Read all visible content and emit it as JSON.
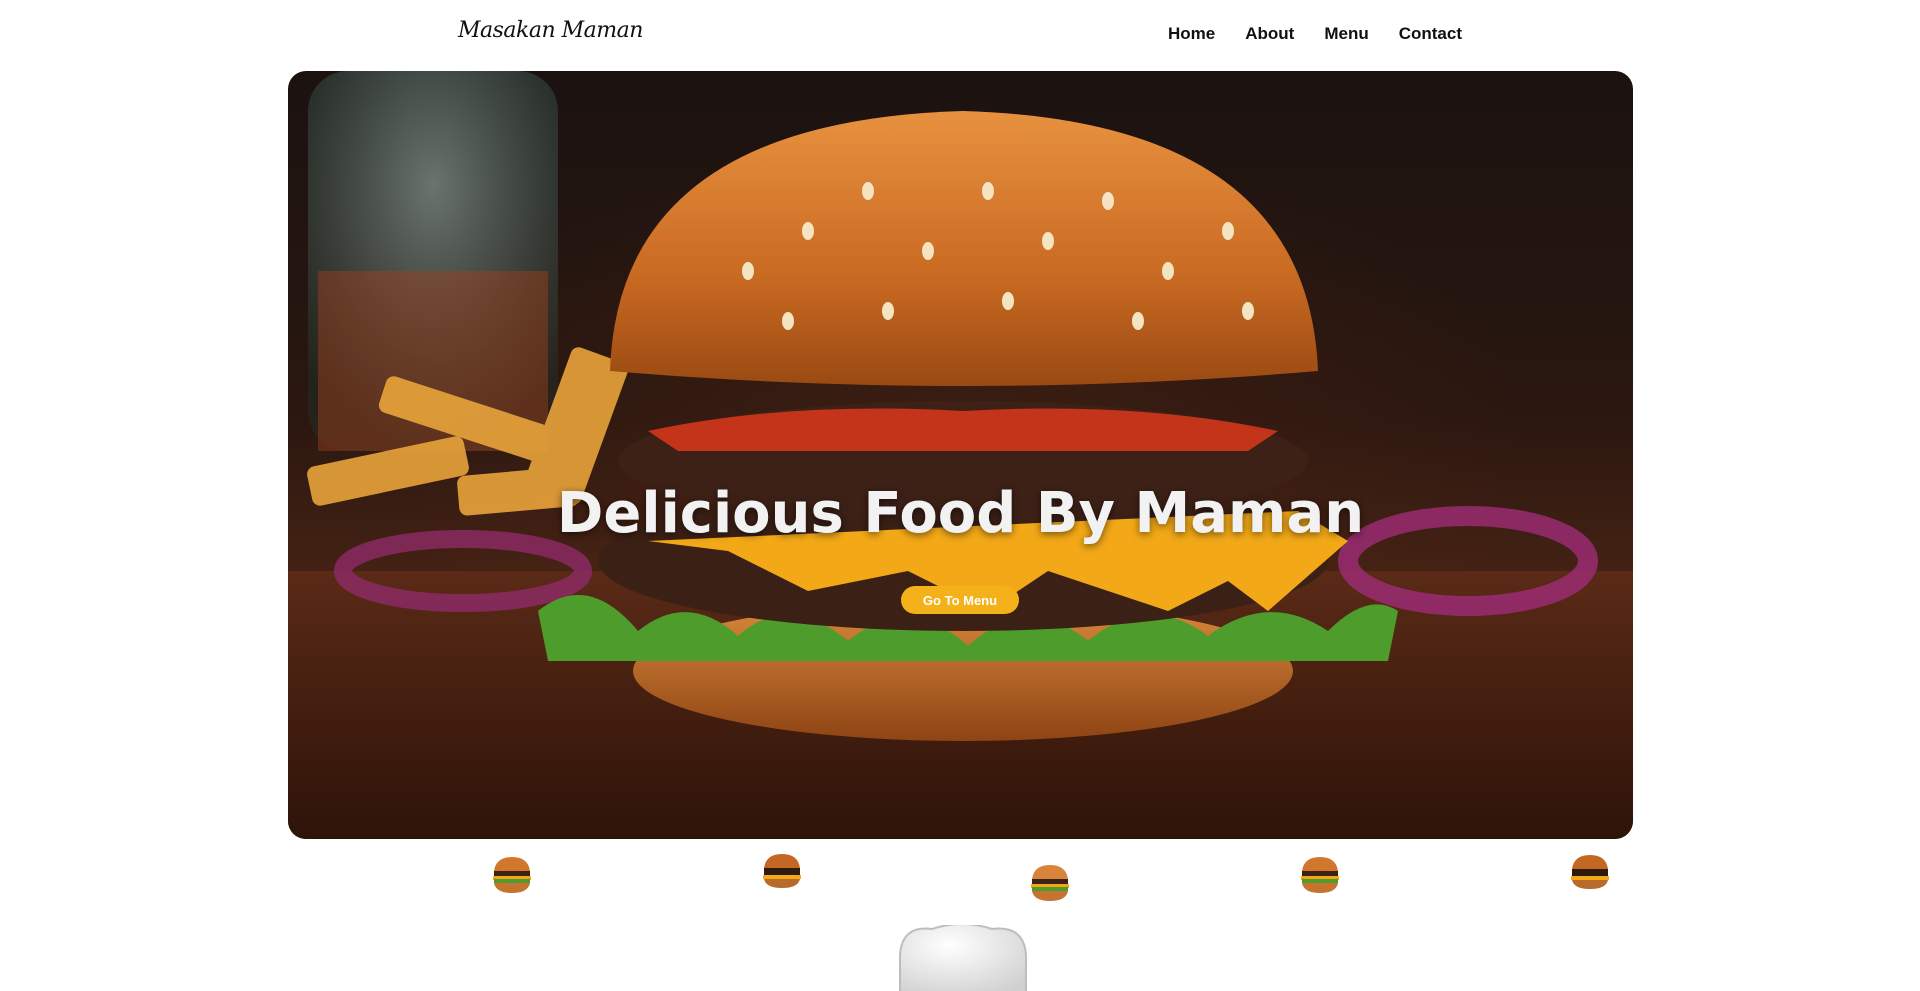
{
  "header": {
    "logo": "Masakan Maman",
    "nav": [
      {
        "label": "Home"
      },
      {
        "label": "About"
      },
      {
        "label": "Menu"
      },
      {
        "label": "Contact"
      }
    ]
  },
  "hero": {
    "title": "Delicious Food By Maman",
    "button_label": "Go To Menu"
  },
  "thumbnails": [
    {
      "icon": "burger-icon"
    },
    {
      "icon": "burger-icon"
    },
    {
      "icon": "burger-icon"
    },
    {
      "icon": "burger-icon"
    },
    {
      "icon": "burger-icon"
    }
  ],
  "colors": {
    "accent": "#f4b11a",
    "text": "#111111",
    "hero_title": "#f2f2f2"
  }
}
